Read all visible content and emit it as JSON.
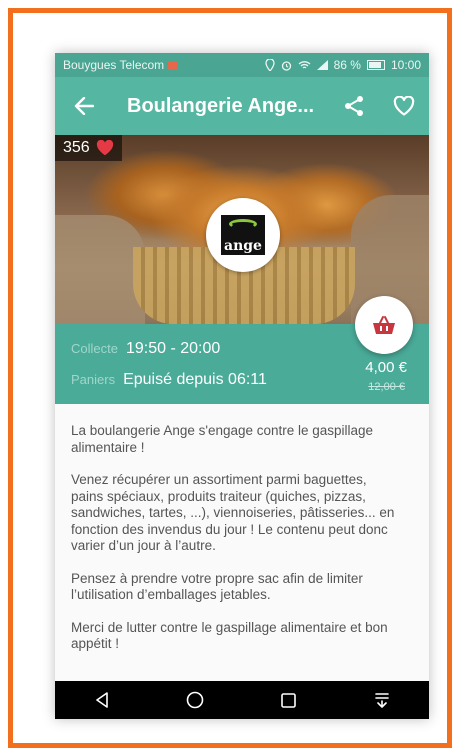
{
  "status_bar": {
    "carrier": "Bouygues Telecom",
    "battery": "86 %",
    "time": "10:00"
  },
  "app_bar": {
    "title": "Boulangerie Ange...",
    "icons": [
      "arrow-left-icon",
      "share-icon",
      "heart-outline-icon"
    ]
  },
  "hero": {
    "likes_count": "356",
    "logo_text": "ange"
  },
  "info": {
    "collect_label": "Collecte",
    "collect_value": "19:50 - 20:00",
    "baskets_label": "Paniers",
    "baskets_value": "Epuisé depuis 06:11",
    "price": "4,00 €",
    "old_price": "12,00 €"
  },
  "description": [
    "La boulangerie Ange s'engage contre le gaspillage alimentaire !",
    "Venez récupérer un assortiment parmi baguettes, pains spéciaux, produits traiteur (quiches, pizzas, sandwiches, tartes, ...), viennoiseries, pâtisseries... en fonction des invendus du jour ! Le contenu peut donc varier d’un jour à l’autre.",
    "Pensez à prendre votre propre sac afin de limiter l’utilisation d’emballages jetables.",
    "Merci de lutter contre le gaspillage alimentaire et bon appétit !"
  ],
  "colors": {
    "frame": "#f26f1d",
    "app_bar": "#55b6a2",
    "info_panel": "#4aab98",
    "heart": "#e53945",
    "basket": "#c8373f"
  },
  "nav_icons": [
    "back-triangle-icon",
    "home-circle-icon",
    "recents-square-icon",
    "notifications-icon"
  ]
}
